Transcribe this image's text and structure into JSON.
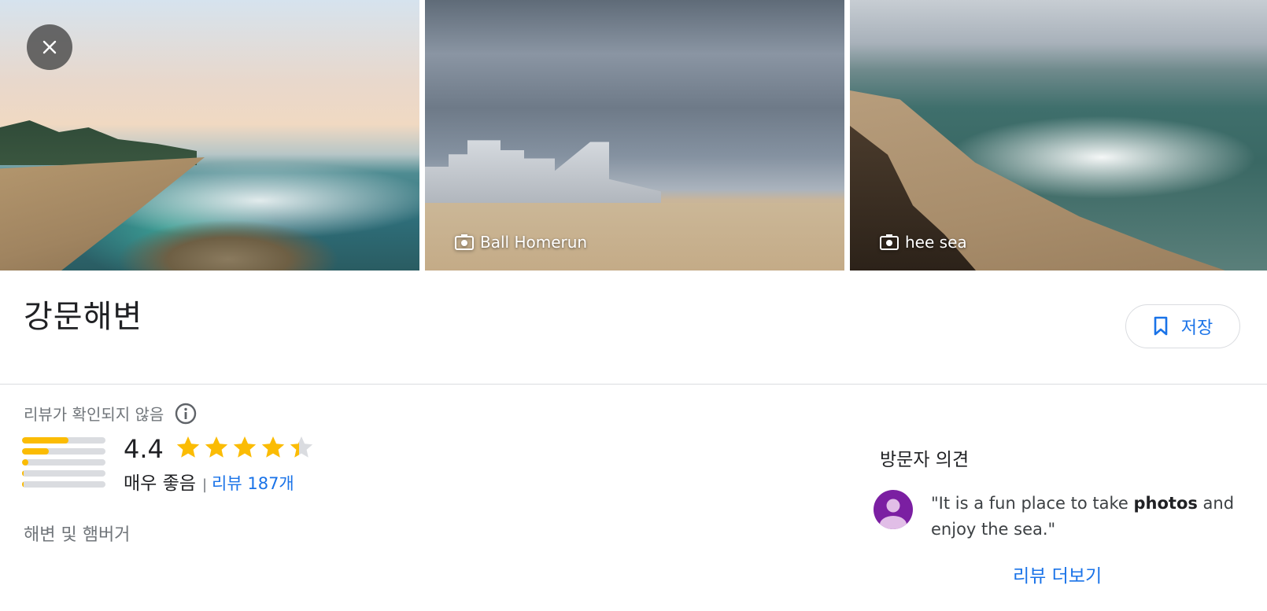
{
  "photos": [
    {
      "caption": ""
    },
    {
      "caption": "Ball Homerun"
    },
    {
      "caption": "hee sea"
    }
  ],
  "place": {
    "title": "강문해변",
    "save_label": "저장"
  },
  "rating": {
    "unverified_note": "리뷰가 확인되지 않음",
    "score": "4.4",
    "stars": 4.4,
    "label": "매우 좋음",
    "separator": "|",
    "reviews_link": "리뷰 187개",
    "distribution": [
      0.56,
      0.32,
      0.08,
      0.02,
      0.02
    ]
  },
  "category": "해변 및 햄버거",
  "visitor": {
    "title": "방문자 의견",
    "quote_before": "\"It is a fun place to take ",
    "quote_bold": "photos",
    "quote_after": " and enjoy the sea.\"",
    "more_link": "리뷰 더보기"
  },
  "colors": {
    "accent": "#1a73e8",
    "star": "#fbbc04",
    "avatar": "#7b1fa2"
  },
  "icons": {
    "close": "close-icon",
    "camera": "camera-icon",
    "bookmark": "bookmark-icon",
    "info": "info-icon",
    "star": "star-icon",
    "avatar": "person-icon"
  }
}
